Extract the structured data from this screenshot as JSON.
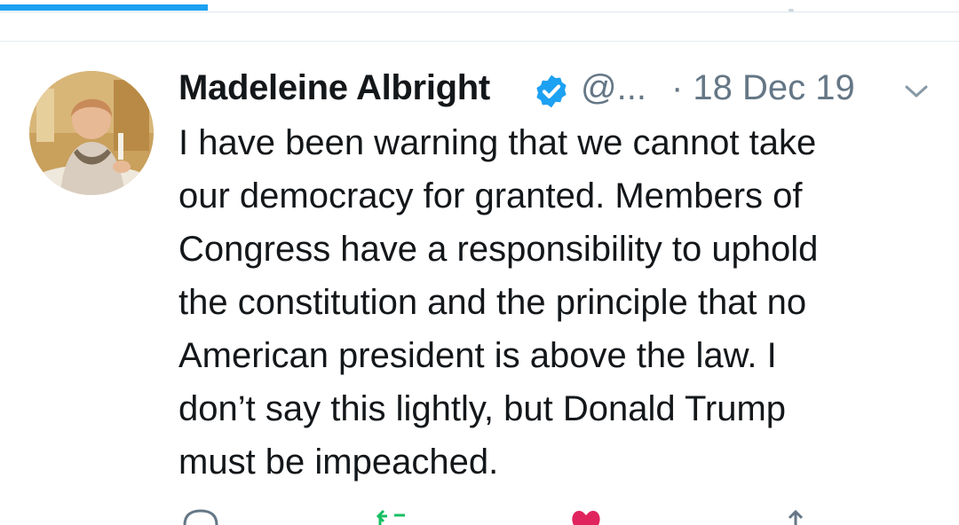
{
  "tweet": {
    "display_name": "Madeleine Albright",
    "handle": "@...",
    "time": "· 18 Dec 19",
    "text_lines": [
      "I have been warning that we cannot take",
      "our democracy for granted. Members of",
      "Congress have a responsibility to uphold",
      "the constitution and the principle that no",
      "American president is above the law. I",
      "don’t say this lightly, but Donald Trump",
      "must be impeached."
    ]
  },
  "colors": {
    "accent": "#1da1f2",
    "text": "#14171a",
    "secondary": "#657786",
    "retweet": "#17bf63",
    "like": "#e0245e"
  },
  "icons": {
    "verified": "verified-badge-icon",
    "caret": "chevron-down-icon",
    "reply": "reply-icon",
    "retweet": "retweet-icon",
    "like": "heart-icon",
    "share": "share-icon"
  }
}
